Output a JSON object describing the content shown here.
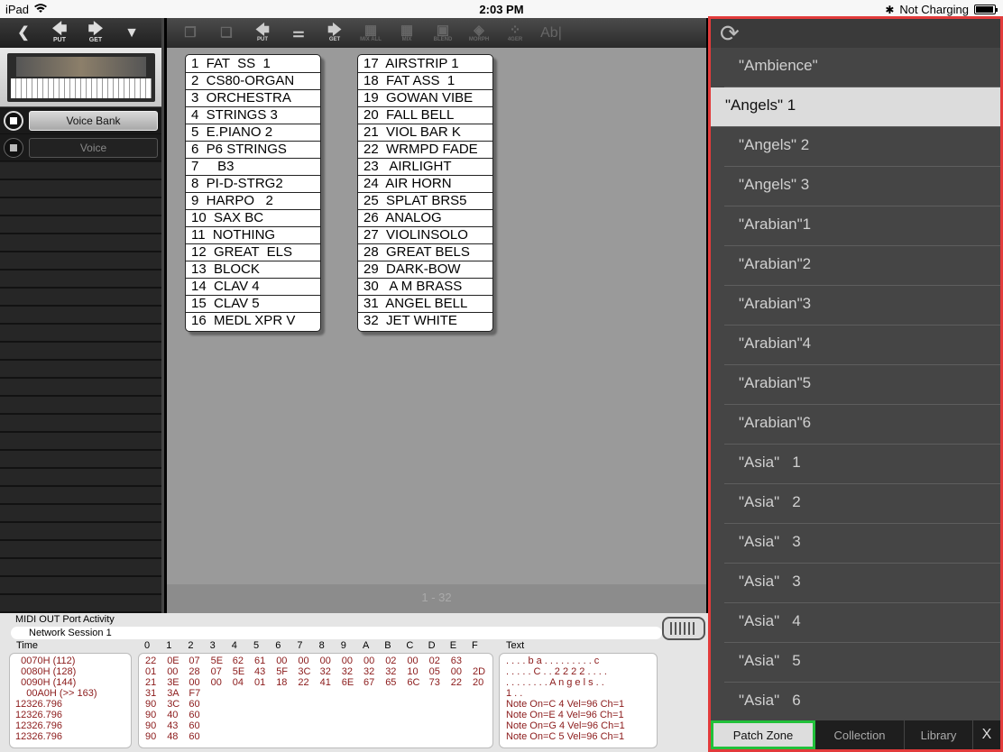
{
  "status_bar": {
    "device": "iPad",
    "time": "2:03 PM",
    "charging": "Not Charging",
    "battery_level": 0.95
  },
  "left_toolbar": {
    "put_label": "PUT",
    "get_label": "GET"
  },
  "selectors": {
    "voice_bank_label": "Voice Bank",
    "voice_label": "Voice"
  },
  "center_toolbar": {
    "put_label": "PUT",
    "get_label": "GET",
    "mix_all_label": "MIX ALL",
    "mix_label": "MIX",
    "blend_label": "BLEND",
    "morph_label": "MORPH",
    "tiger_label": "4GER",
    "rename_label": "Ab|"
  },
  "voice_bank_left": [
    "1  FAT  SS  1",
    "2  CS80-ORGAN",
    "3  ORCHESTRA",
    "4  STRINGS 3",
    "5  E.PIANO 2",
    "6  P6 STRINGS",
    "7     B3",
    "8  PI-D-STRG2",
    "9  HARPO   2",
    "10  SAX BC",
    "11  NOTHING",
    "12  GREAT  ELS",
    "13  BLOCK",
    "14  CLAV 4",
    "15  CLAV 5",
    "16  MEDL XPR V"
  ],
  "voice_bank_right": [
    "17  AIRSTRIP 1",
    "18  FAT ASS  1",
    "19  GOWAN VIBE",
    "20  FALL BELL",
    "21  VIOL BAR K",
    "22  WRMPD FADE",
    "23   AIRLIGHT",
    "24  AIR HORN",
    "25  SPLAT BRS5",
    "26  ANALOG",
    "27  VIOLINSOLO",
    "28  GREAT BELS",
    "29  DARK-BOW",
    "30   A M BRASS",
    "31  ANGEL BELL",
    "32  JET WHITE"
  ],
  "page_indicator": "1 - 32",
  "midi": {
    "title": "MIDI OUT Port Activity",
    "session": "Network Session 1",
    "time_header": "Time",
    "text_header": "Text",
    "hex_headers": [
      "0",
      "1",
      "2",
      "3",
      "4",
      "5",
      "6",
      "7",
      "8",
      "9",
      "A",
      "B",
      "C",
      "D",
      "E",
      "F"
    ],
    "time_lines": [
      "  0070H (112)",
      "  0080H (128)",
      "  0090H (144)",
      "    00A0H (>> 163)",
      "12326.796",
      "12326.796",
      "12326.796",
      "12326.796"
    ],
    "hex_rows": [
      [
        "22",
        "0E",
        "07",
        "5E",
        "62",
        "61",
        "00",
        "00",
        "00",
        "00",
        "00",
        "02",
        "00",
        "02",
        "63"
      ],
      [
        "01",
        "00",
        "28",
        "07",
        "5E",
        "43",
        "5F",
        "3C",
        "32",
        "32",
        "32",
        "32",
        "10",
        "05",
        "00",
        "2D"
      ],
      [
        "21",
        "3E",
        "00",
        "00",
        "04",
        "01",
        "18",
        "22",
        "41",
        "6E",
        "67",
        "65",
        "6C",
        "73",
        "22",
        "20"
      ],
      [
        "31",
        "3A",
        "F7"
      ],
      [
        "90",
        "3C",
        "60"
      ],
      [
        "90",
        "40",
        "60"
      ],
      [
        "90",
        "43",
        "60"
      ],
      [
        "90",
        "48",
        "60"
      ]
    ],
    "text_lines": [
      ". . . . b a . . . . . . . . . c",
      ". . . . . C . . 2 2 2 2 . . . .",
      ". . . . . . . . A n g e l s . .",
      "1 . .",
      "Note On=C 4 Vel=96 Ch=1",
      "Note On=E 4 Vel=96 Ch=1",
      "Note On=G 4 Vel=96 Ch=1",
      "Note On=C 5 Vel=96 Ch=1"
    ]
  },
  "patch_list": [
    "\"Ambience\"",
    "\"Angels\" 1",
    "\"Angels\" 2",
    "\"Angels\" 3",
    "\"Arabian\"1",
    "\"Arabian\"2",
    "\"Arabian\"3",
    "\"Arabian\"4",
    "\"Arabian\"5",
    "\"Arabian\"6",
    "\"Asia\"   1",
    "\"Asia\"   2",
    "\"Asia\"   3",
    "\"Asia\"   3",
    "\"Asia\"   4",
    "\"Asia\"   5",
    "\"Asia\"   6"
  ],
  "patch_selected_index": 1,
  "bottom_tabs": {
    "patch_zone": "Patch Zone",
    "collection": "Collection",
    "library": "Library",
    "close": "X"
  }
}
